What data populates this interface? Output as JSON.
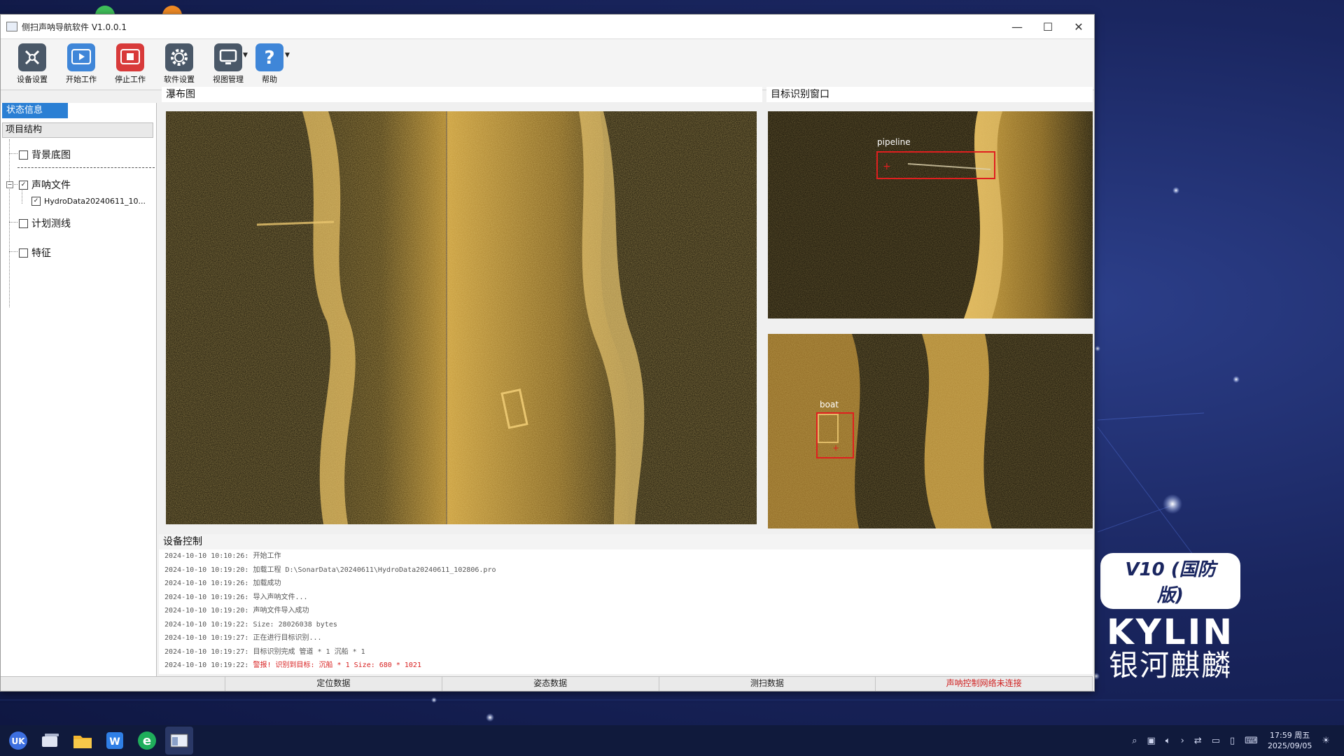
{
  "window": {
    "title": "侧扫声呐导航软件 V1.0.0.1",
    "controls": {
      "minimize": "—",
      "maximize": "☐",
      "close": "✕"
    }
  },
  "toolbar": {
    "items": [
      {
        "label": "设备设置",
        "icon": "device-settings-icon",
        "color": "#4a5868"
      },
      {
        "label": "开始工作",
        "icon": "play-icon",
        "color": "#3f86d8"
      },
      {
        "label": "停止工作",
        "icon": "stop-icon",
        "color": "#d83a3a"
      },
      {
        "label": "软件设置",
        "icon": "gear-icon",
        "color": "#4a5868"
      },
      {
        "label": "视图管理",
        "icon": "monitor-icon",
        "color": "#4a5868"
      },
      {
        "label": "帮助",
        "icon": "help-icon",
        "color": "#3f86d8"
      }
    ]
  },
  "left_panel": {
    "tab": "状态信息",
    "header": "项目结构",
    "tree": {
      "background": "背景底图",
      "sonar_files": "声呐文件",
      "sonar_file_item": "HydroData20240611_10...",
      "plan_lines": "计划测线",
      "features": "特征"
    }
  },
  "panels": {
    "main_view_title": "瀑布图",
    "target_window_title": "目标识别窗口",
    "device_control_title": "设备控制",
    "detections": [
      {
        "label": "pipeline"
      },
      {
        "label": "boat"
      }
    ]
  },
  "log": {
    "lines": [
      {
        "time": "2024-10-10 10:10:26:",
        "msg": "开始工作"
      },
      {
        "time": "2024-10-10 10:19:20:",
        "msg": "加载工程 D:\\SonarData\\20240611\\HydroData20240611_102806.pro"
      },
      {
        "time": "2024-10-10 10:19:26:",
        "msg": "加载成功"
      },
      {
        "time": "2024-10-10 10:19:26:",
        "msg": "导入声呐文件..."
      },
      {
        "time": "2024-10-10 10:19:20:",
        "msg": "声呐文件导入成功"
      },
      {
        "time": "2024-10-10 10:19:22:",
        "msg": "Size: 28026038 bytes"
      },
      {
        "time": "2024-10-10 10:19:27:",
        "msg": "正在进行目标识别..."
      },
      {
        "time": "2024-10-10 10:19:27:",
        "msg": "目标识别完成 管道 * 1 沉船 * 1"
      },
      {
        "time": "2024-10-10 10:19:22:",
        "msg": "警报! 识别到目标: 沉船 * 1 Size: 680 * 1021",
        "error": true
      }
    ]
  },
  "statusbar": {
    "cells": [
      "",
      "定位数据",
      "姿态数据",
      "测扫数据",
      "声呐控制网络未连接"
    ]
  },
  "brand": {
    "badge": "V10 (国防版)",
    "name": "KYLIN",
    "cn": "银河麒麟"
  },
  "taskbar": {
    "apps": [
      "start-icon",
      "multitask-icon",
      "file-manager-icon",
      "wps-icon",
      "browser-icon",
      "sonar-app-icon"
    ],
    "clock_time": "17:59 周五",
    "clock_date": "2025/09/05"
  }
}
